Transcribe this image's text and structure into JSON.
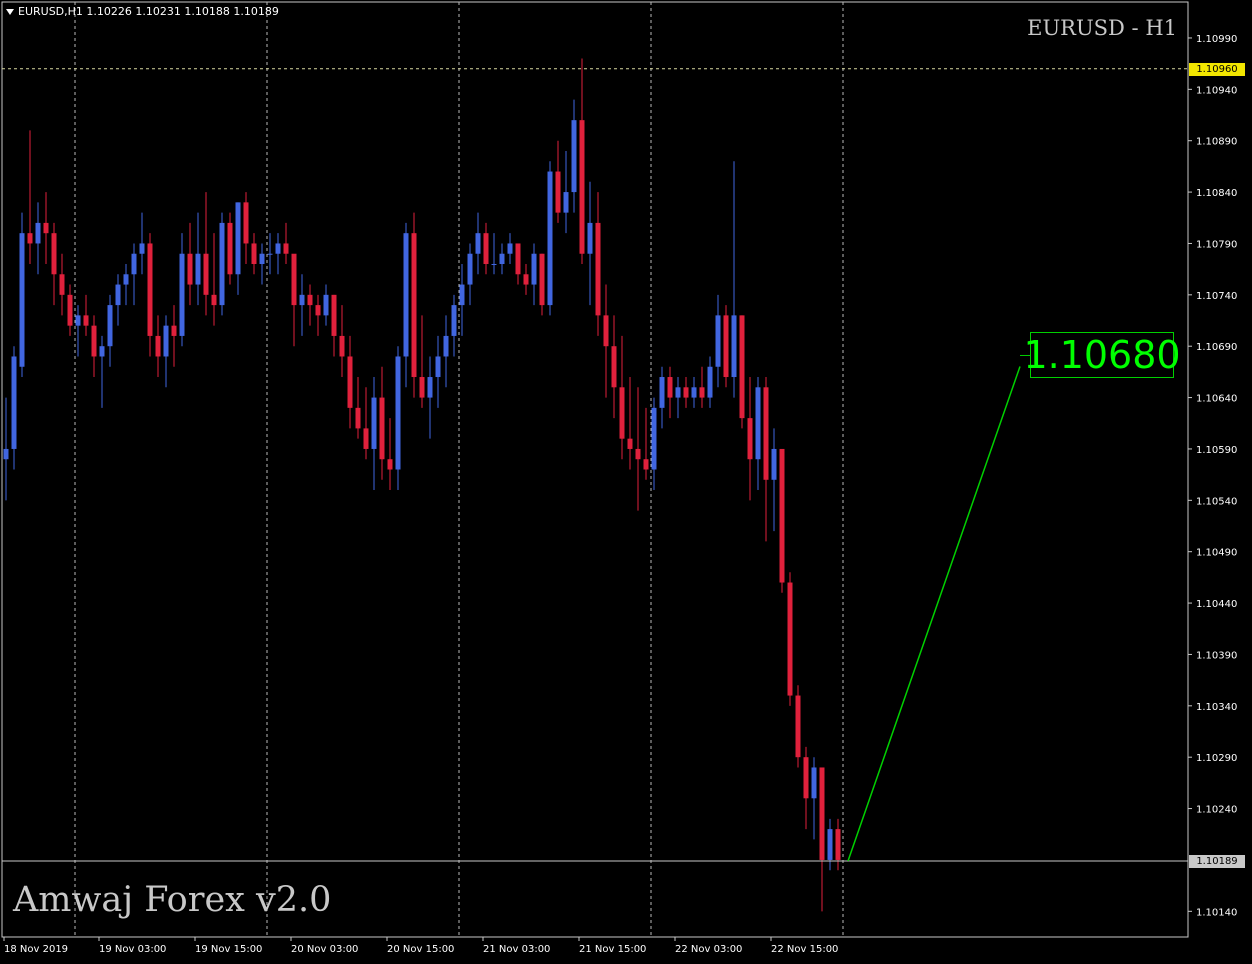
{
  "window": {
    "symbol_info": "EURUSD,H1  1.10226 1.10231 1.10188 1.10189",
    "chart_title": "EURUSD - H1",
    "indicator_name": "Amwaj Forex v2.0"
  },
  "target": {
    "label": "1.10680",
    "price": 1.1068
  },
  "horizontal_line": {
    "label": "1.10960",
    "price": 1.1096
  },
  "bid_line": {
    "label": "1.10189",
    "price": 1.10189
  },
  "colors": {
    "background": "#000000",
    "bull_candle": "#4166e0",
    "bear_candle": "#e0213c",
    "grid": "#b8b8b8",
    "target_line": "#00d000",
    "hline_tag": "#f2e600"
  },
  "chart_data": {
    "type": "candlestick",
    "title": "EURUSD - H1",
    "ylim": [
      1.10115,
      1.11025
    ],
    "y_ticks": [
      "1.10990",
      "1.10940",
      "1.10890",
      "1.10840",
      "1.10790",
      "1.10740",
      "1.10690",
      "1.10640",
      "1.10590",
      "1.10540",
      "1.10490",
      "1.10440",
      "1.10390",
      "1.10340",
      "1.10290",
      "1.10240",
      "1.10140"
    ],
    "x_ticks": [
      "18 Nov 2019",
      "19 Nov 03:00",
      "19 Nov 15:00",
      "20 Nov 03:00",
      "20 Nov 15:00",
      "21 Nov 03:00",
      "21 Nov 15:00",
      "22 Nov 03:00",
      "22 Nov 15:00"
    ],
    "grid": true,
    "candles": [
      [
        1.1058,
        1.1064,
        1.1054,
        1.1059
      ],
      [
        1.1059,
        1.1069,
        1.1057,
        1.1068
      ],
      [
        1.1067,
        1.1082,
        1.1066,
        1.108
      ],
      [
        1.108,
        1.109,
        1.1077,
        1.1079
      ],
      [
        1.1079,
        1.1083,
        1.1076,
        1.1081
      ],
      [
        1.1081,
        1.1084,
        1.1077,
        1.108
      ],
      [
        1.108,
        1.1081,
        1.1073,
        1.1076
      ],
      [
        1.1076,
        1.1078,
        1.1072,
        1.1074
      ],
      [
        1.1074,
        1.1075,
        1.107,
        1.1071
      ],
      [
        1.1071,
        1.1073,
        1.1068,
        1.1072
      ],
      [
        1.1072,
        1.1074,
        1.107,
        1.1071
      ],
      [
        1.1071,
        1.1072,
        1.1066,
        1.1068
      ],
      [
        1.1068,
        1.107,
        1.1063,
        1.1069
      ],
      [
        1.1069,
        1.1074,
        1.1067,
        1.1073
      ],
      [
        1.1073,
        1.1076,
        1.1071,
        1.1075
      ],
      [
        1.1075,
        1.1077,
        1.1073,
        1.1076
      ],
      [
        1.1076,
        1.1079,
        1.1073,
        1.1078
      ],
      [
        1.1078,
        1.1082,
        1.1076,
        1.1079
      ],
      [
        1.1079,
        1.108,
        1.1068,
        1.107
      ],
      [
        1.107,
        1.1072,
        1.1066,
        1.1068
      ],
      [
        1.1068,
        1.1072,
        1.1065,
        1.1071
      ],
      [
        1.1071,
        1.1073,
        1.1067,
        1.107
      ],
      [
        1.107,
        1.108,
        1.1069,
        1.1078
      ],
      [
        1.1078,
        1.1081,
        1.1073,
        1.1075
      ],
      [
        1.1075,
        1.1082,
        1.1073,
        1.1078
      ],
      [
        1.1078,
        1.1084,
        1.1072,
        1.1074
      ],
      [
        1.1074,
        1.108,
        1.1071,
        1.1073
      ],
      [
        1.1073,
        1.1082,
        1.1072,
        1.1081
      ],
      [
        1.1081,
        1.1082,
        1.1075,
        1.1076
      ],
      [
        1.1076,
        1.1083,
        1.1074,
        1.1083
      ],
      [
        1.1083,
        1.1084,
        1.1077,
        1.1079
      ],
      [
        1.1079,
        1.108,
        1.1076,
        1.1077
      ],
      [
        1.1077,
        1.1079,
        1.1075,
        1.1078
      ],
      [
        1.1078,
        1.108,
        1.1076,
        1.1078
      ],
      [
        1.1078,
        1.108,
        1.1076,
        1.1079
      ],
      [
        1.1079,
        1.1081,
        1.1077,
        1.1078
      ],
      [
        1.1078,
        1.1077,
        1.1069,
        1.1073
      ],
      [
        1.1073,
        1.1076,
        1.107,
        1.1074
      ],
      [
        1.1074,
        1.1075,
        1.1071,
        1.1073
      ],
      [
        1.1073,
        1.1074,
        1.107,
        1.1072
      ],
      [
        1.1072,
        1.1075,
        1.1071,
        1.1074
      ],
      [
        1.1074,
        1.1074,
        1.1068,
        1.107
      ],
      [
        1.107,
        1.1073,
        1.1066,
        1.1068
      ],
      [
        1.1068,
        1.107,
        1.1061,
        1.1063
      ],
      [
        1.1063,
        1.1066,
        1.106,
        1.1061
      ],
      [
        1.1061,
        1.1065,
        1.1058,
        1.1059
      ],
      [
        1.1059,
        1.1066,
        1.1055,
        1.1064
      ],
      [
        1.1064,
        1.1067,
        1.1056,
        1.1058
      ],
      [
        1.1058,
        1.1062,
        1.1055,
        1.1057
      ],
      [
        1.1057,
        1.1069,
        1.1055,
        1.1068
      ],
      [
        1.1068,
        1.1081,
        1.1065,
        1.108
      ],
      [
        1.108,
        1.1082,
        1.1064,
        1.1066
      ],
      [
        1.1066,
        1.1072,
        1.1063,
        1.1064
      ],
      [
        1.1064,
        1.1068,
        1.106,
        1.1066
      ],
      [
        1.1066,
        1.107,
        1.1063,
        1.1068
      ],
      [
        1.1068,
        1.1072,
        1.1065,
        1.107
      ],
      [
        1.107,
        1.1074,
        1.1068,
        1.1073
      ],
      [
        1.1073,
        1.1077,
        1.107,
        1.1075
      ],
      [
        1.1075,
        1.1079,
        1.1073,
        1.1078
      ],
      [
        1.1078,
        1.1082,
        1.1076,
        1.108
      ],
      [
        1.108,
        1.1081,
        1.1076,
        1.1077
      ],
      [
        1.1077,
        1.108,
        1.1076,
        1.1077
      ],
      [
        1.1077,
        1.1079,
        1.1076,
        1.1078
      ],
      [
        1.1078,
        1.108,
        1.1077,
        1.1079
      ],
      [
        1.1079,
        1.1079,
        1.1075,
        1.1076
      ],
      [
        1.1076,
        1.1077,
        1.1074,
        1.1075
      ],
      [
        1.1075,
        1.1079,
        1.1073,
        1.1078
      ],
      [
        1.1078,
        1.1078,
        1.1072,
        1.1073
      ],
      [
        1.1073,
        1.1087,
        1.1072,
        1.1086
      ],
      [
        1.1086,
        1.1089,
        1.1081,
        1.1082
      ],
      [
        1.1082,
        1.1088,
        1.108,
        1.1084
      ],
      [
        1.1084,
        1.1093,
        1.1082,
        1.1091
      ],
      [
        1.1091,
        1.1097,
        1.1077,
        1.1078
      ],
      [
        1.1078,
        1.1085,
        1.1073,
        1.1081
      ],
      [
        1.1081,
        1.1084,
        1.107,
        1.1072
      ],
      [
        1.1072,
        1.1075,
        1.1064,
        1.1069
      ],
      [
        1.1069,
        1.1072,
        1.1062,
        1.1065
      ],
      [
        1.1065,
        1.107,
        1.1058,
        1.106
      ],
      [
        1.106,
        1.1066,
        1.1057,
        1.1059
      ],
      [
        1.1059,
        1.1065,
        1.1053,
        1.1058
      ],
      [
        1.1058,
        1.1063,
        1.1056,
        1.1057
      ],
      [
        1.1057,
        1.1064,
        1.1055,
        1.1063
      ],
      [
        1.1063,
        1.1067,
        1.1061,
        1.1066
      ],
      [
        1.1066,
        1.1067,
        1.1062,
        1.1064
      ],
      [
        1.1064,
        1.1066,
        1.1062,
        1.1065
      ],
      [
        1.1065,
        1.1066,
        1.1063,
        1.1064
      ],
      [
        1.1064,
        1.1066,
        1.1063,
        1.1065
      ],
      [
        1.1065,
        1.1067,
        1.1063,
        1.1064
      ],
      [
        1.1064,
        1.1068,
        1.1063,
        1.1067
      ],
      [
        1.1067,
        1.1074,
        1.1065,
        1.1072
      ],
      [
        1.1072,
        1.1073,
        1.1065,
        1.1066
      ],
      [
        1.1066,
        1.1087,
        1.1064,
        1.1072
      ],
      [
        1.1072,
        1.1072,
        1.1061,
        1.1062
      ],
      [
        1.1062,
        1.1066,
        1.1054,
        1.1058
      ],
      [
        1.1058,
        1.1066,
        1.1055,
        1.1065
      ],
      [
        1.1065,
        1.1066,
        1.105,
        1.1056
      ],
      [
        1.1056,
        1.1061,
        1.1051,
        1.1059
      ],
      [
        1.1059,
        1.1059,
        1.1045,
        1.1046
      ],
      [
        1.1046,
        1.1047,
        1.1034,
        1.1035
      ],
      [
        1.1035,
        1.1036,
        1.1028,
        1.1029
      ],
      [
        1.1029,
        1.103,
        1.1022,
        1.1025
      ],
      [
        1.1025,
        1.1029,
        1.1021,
        1.1028
      ],
      [
        1.1028,
        1.1028,
        1.1014,
        1.1019
      ],
      [
        1.1019,
        1.1023,
        1.1018,
        1.1022
      ],
      [
        1.1022,
        1.1023,
        1.1018,
        1.1019
      ]
    ]
  }
}
